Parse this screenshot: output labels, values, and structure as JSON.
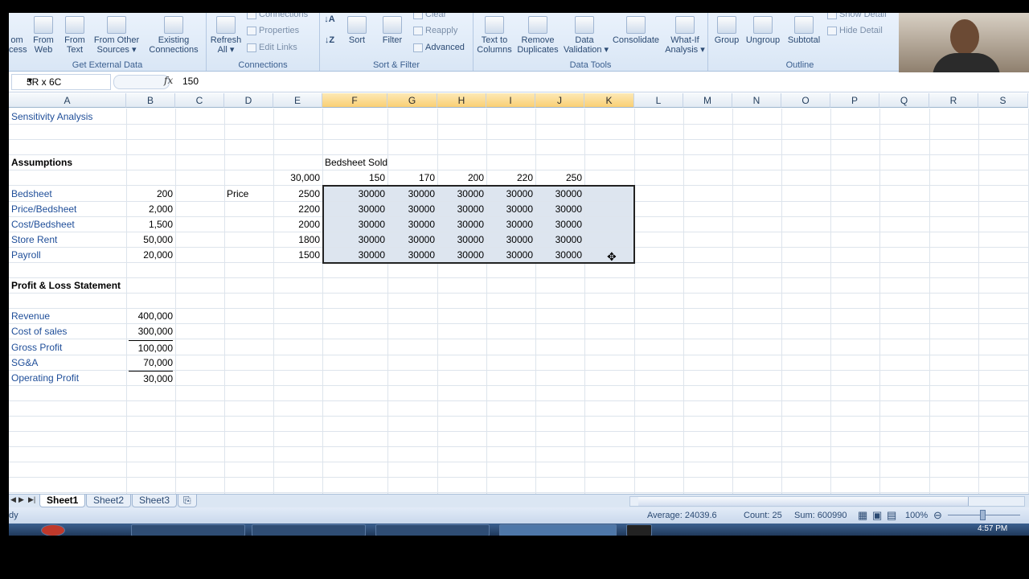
{
  "ribbon": {
    "groups": [
      {
        "label": "Get External Data"
      },
      {
        "label": "Connections"
      },
      {
        "label": "Sort & Filter"
      },
      {
        "label": "Data Tools"
      },
      {
        "label": "Outline"
      }
    ],
    "buttons": {
      "from_access": "om\ncess",
      "from_web": "From\nWeb",
      "from_text": "From\nText",
      "from_other": "From Other\nSources ▾",
      "existing": "Existing\nConnections",
      "refresh": "Refresh\nAll ▾",
      "connections": "Connections",
      "properties": "Properties",
      "edit_links": "Edit Links",
      "sort": "Sort",
      "filter": "Filter",
      "clear": "Clear",
      "reapply": "Reapply",
      "advanced": "Advanced",
      "text_to_columns": "Text to\nColumns",
      "remove_duplicates": "Remove\nDuplicates",
      "data_validation": "Data\nValidation ▾",
      "consolidate": "Consolidate",
      "what_if": "What-If\nAnalysis ▾",
      "group": "Group",
      "ungroup": "Ungroup",
      "subtotal": "Subtotal",
      "show_detail": "Show Detail",
      "hide_detail": "Hide Detail"
    }
  },
  "formula_bar": {
    "name_box": "5R x 6C",
    "fx": "fx",
    "value": "150"
  },
  "columns": [
    "A",
    "B",
    "C",
    "D",
    "E",
    "F",
    "G",
    "H",
    "I",
    "J",
    "K",
    "L",
    "M",
    "N",
    "O",
    "P",
    "Q",
    "R",
    "S"
  ],
  "cells": {
    "A1": "Sensitivity Analysis",
    "A4": "Assumptions",
    "F4": "Bedsheet Sold",
    "E5": "30,000",
    "F5": "150",
    "G5": "170",
    "H5": "200",
    "I5": "220",
    "J5": "250",
    "A6": "Bedsheet",
    "B6": "200",
    "D6": "Price",
    "A7": "Price/Bedsheet",
    "B7": "2,000",
    "A8": "Cost/Bedsheet",
    "B8": "1,500",
    "A9": "Store Rent",
    "B9": "50,000",
    "A10": "Payroll",
    "B10": "20,000",
    "E6": "2500",
    "E7": "2200",
    "E8": "2000",
    "E9": "1800",
    "E10": "1500",
    "F6": "30000",
    "G6": "30000",
    "H6": "30000",
    "I6": "30000",
    "J6": "30000",
    "F7": "30000",
    "G7": "30000",
    "H7": "30000",
    "I7": "30000",
    "J7": "30000",
    "F8": "30000",
    "G8": "30000",
    "H8": "30000",
    "I8": "30000",
    "J8": "30000",
    "F9": "30000",
    "G9": "30000",
    "H9": "30000",
    "I9": "30000",
    "J9": "30000",
    "F10": "30000",
    "G10": "30000",
    "H10": "30000",
    "I10": "30000",
    "J10": "30000",
    "A12": "Profit & Loss Statement",
    "A14": "Revenue",
    "B14": "400,000",
    "A15": "Cost of sales",
    "B15": "300,000",
    "A16": "Gross Profit",
    "B16": "100,000",
    "A17": "SG&A",
    "B17": "70,000",
    "A18": "Operating Profit",
    "B18": "30,000"
  },
  "sheets": [
    {
      "name": "Sheet1",
      "active": true
    },
    {
      "name": "Sheet2",
      "active": false
    },
    {
      "name": "Sheet3",
      "active": false
    }
  ],
  "status": {
    "mode": "dy",
    "average": "Average: 24039.6",
    "count": "Count: 25",
    "sum": "Sum: 600990",
    "zoom": "100%"
  },
  "clock": "4:57 PM",
  "colors": {
    "accent": "#1f4e99",
    "selection": "#dde5ef"
  }
}
